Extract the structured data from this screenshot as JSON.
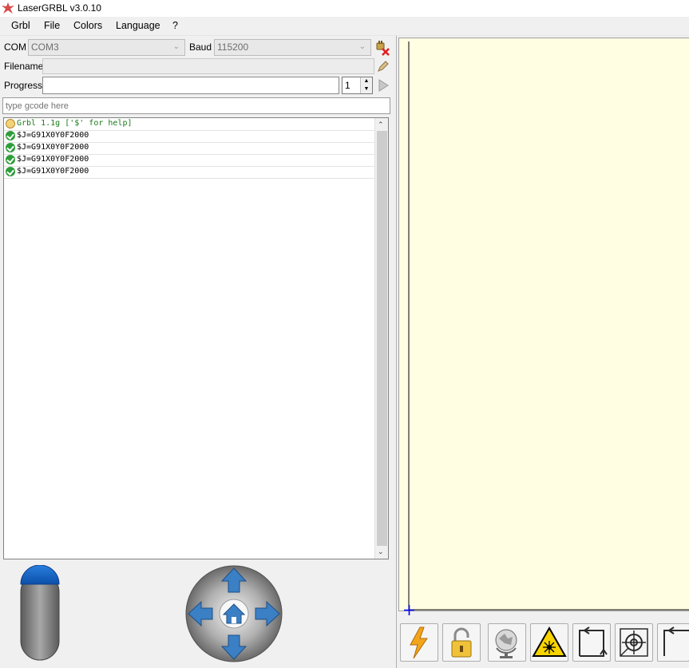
{
  "window": {
    "title": "LaserGRBL v3.0.10"
  },
  "menu": [
    "Grbl",
    "File",
    "Colors",
    "Language",
    "?"
  ],
  "connection": {
    "com_label": "COM",
    "com_value": "COM3",
    "baud_label": "Baud",
    "baud_value": "115200",
    "filename_label": "Filename",
    "filename_value": "",
    "progress_label": "Progress",
    "progress_fraction": 0,
    "passes_value": "1"
  },
  "command": {
    "placeholder": "type gcode here"
  },
  "console": {
    "lines": [
      {
        "text": "Grbl 1.1g ['$' for help]",
        "icon": "grbl-info-icon",
        "color": "#1a7a1a"
      },
      {
        "text": "$J=G91X0Y0F2000",
        "icon": "ok-icon",
        "color": "#000000"
      },
      {
        "text": "$J=G91X0Y0F2000",
        "icon": "ok-icon",
        "color": "#000000"
      },
      {
        "text": "$J=G91X0Y0F2000",
        "icon": "ok-icon",
        "color": "#000000"
      },
      {
        "text": "$J=G91X0Y0F2000",
        "icon": "ok-icon",
        "color": "#000000"
      }
    ]
  },
  "colors": {
    "preview_bg": "#fffde2",
    "jog_arrow": "#3b7fc4",
    "origin_cross": "#0000ff"
  },
  "toolbar": [
    "reset-lightning-icon",
    "unlock-padlock-icon",
    "globe-icon",
    "laser-warning-icon",
    "frame-corners-icon",
    "crosshair-target-icon",
    "frame-icon"
  ]
}
